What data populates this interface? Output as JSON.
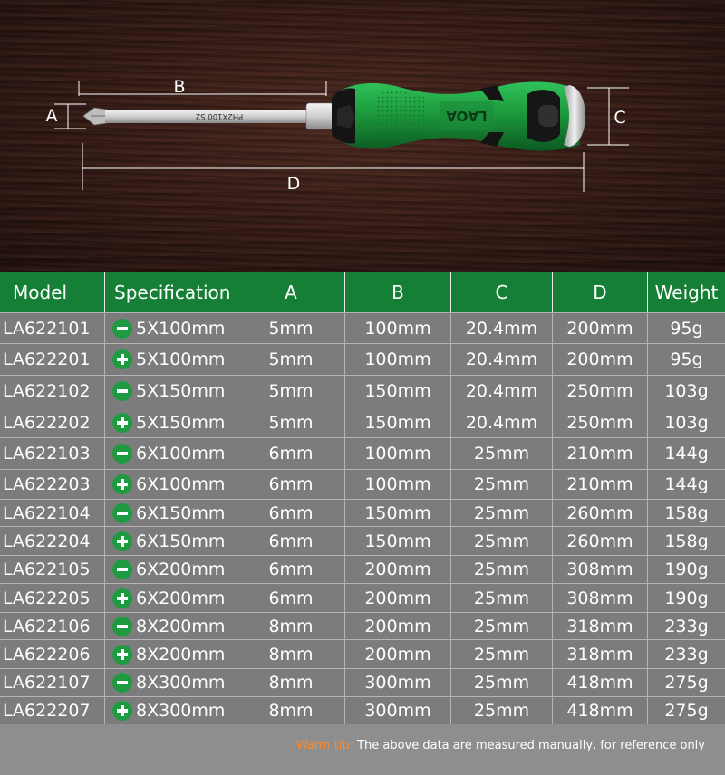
{
  "diagram": {
    "dimension_labels": {
      "a": "A",
      "b": "B",
      "c": "C",
      "d": "D"
    },
    "shaft_marking": "PH2X100 S2",
    "handle_brand": "LAOA",
    "colors": {
      "handle": "#1d9a3c",
      "shaft": "#d8d8d8"
    }
  },
  "table": {
    "header_color": "#157f35",
    "columns": [
      "Model",
      "Specification",
      "A",
      "B",
      "C",
      "D",
      "Weight"
    ],
    "rows": [
      {
        "model": "LA622101",
        "tip": "minus-icon",
        "spec": "5X100mm",
        "a": "5mm",
        "b": "100mm",
        "c": "20.4mm",
        "d": "200mm",
        "weight": "95g"
      },
      {
        "model": "LA622201",
        "tip": "plus-icon",
        "spec": "5X100mm",
        "a": "5mm",
        "b": "100mm",
        "c": "20.4mm",
        "d": "200mm",
        "weight": "95g"
      },
      {
        "model": "LA622102",
        "tip": "minus-icon",
        "spec": "5X150mm",
        "a": "5mm",
        "b": "150mm",
        "c": "20.4mm",
        "d": "250mm",
        "weight": "103g"
      },
      {
        "model": "LA622202",
        "tip": "plus-icon",
        "spec": "5X150mm",
        "a": "5mm",
        "b": "150mm",
        "c": "20.4mm",
        "d": "250mm",
        "weight": "103g"
      },
      {
        "model": "LA622103",
        "tip": "minus-icon",
        "spec": "6X100mm",
        "a": "6mm",
        "b": "100mm",
        "c": "25mm",
        "d": "210mm",
        "weight": "144g"
      },
      {
        "model": "LA622203",
        "tip": "plus-icon",
        "spec": "6X100mm",
        "a": "6mm",
        "b": "100mm",
        "c": "25mm",
        "d": "210mm",
        "weight": "144g"
      },
      {
        "model": "LA622104",
        "tip": "minus-icon",
        "spec": "6X150mm",
        "a": "6mm",
        "b": "150mm",
        "c": "25mm",
        "d": "260mm",
        "weight": "158g"
      },
      {
        "model": "LA622204",
        "tip": "plus-icon",
        "spec": "6X150mm",
        "a": "6mm",
        "b": "150mm",
        "c": "25mm",
        "d": "260mm",
        "weight": "158g"
      },
      {
        "model": "LA622105",
        "tip": "minus-icon",
        "spec": "6X200mm",
        "a": "6mm",
        "b": "200mm",
        "c": "25mm",
        "d": "308mm",
        "weight": "190g"
      },
      {
        "model": "LA622205",
        "tip": "plus-icon",
        "spec": "6X200mm",
        "a": "6mm",
        "b": "200mm",
        "c": "25mm",
        "d": "308mm",
        "weight": "190g"
      },
      {
        "model": "LA622106",
        "tip": "minus-icon",
        "spec": "8X200mm",
        "a": "8mm",
        "b": "200mm",
        "c": "25mm",
        "d": "318mm",
        "weight": "233g"
      },
      {
        "model": "LA622206",
        "tip": "plus-icon",
        "spec": "8X200mm",
        "a": "8mm",
        "b": "200mm",
        "c": "25mm",
        "d": "318mm",
        "weight": "233g"
      },
      {
        "model": "LA622107",
        "tip": "minus-icon",
        "spec": "8X300mm",
        "a": "8mm",
        "b": "300mm",
        "c": "25mm",
        "d": "418mm",
        "weight": "275g"
      },
      {
        "model": "LA622207",
        "tip": "plus-icon",
        "spec": "8X300mm",
        "a": "8mm",
        "b": "300mm",
        "c": "25mm",
        "d": "418mm",
        "weight": "275g"
      }
    ]
  },
  "footer": {
    "tip_label": "Warm tip:",
    "tip_text": "The above data are measured manually, for reference only",
    "tip_label_color": "#ff8a2a"
  }
}
